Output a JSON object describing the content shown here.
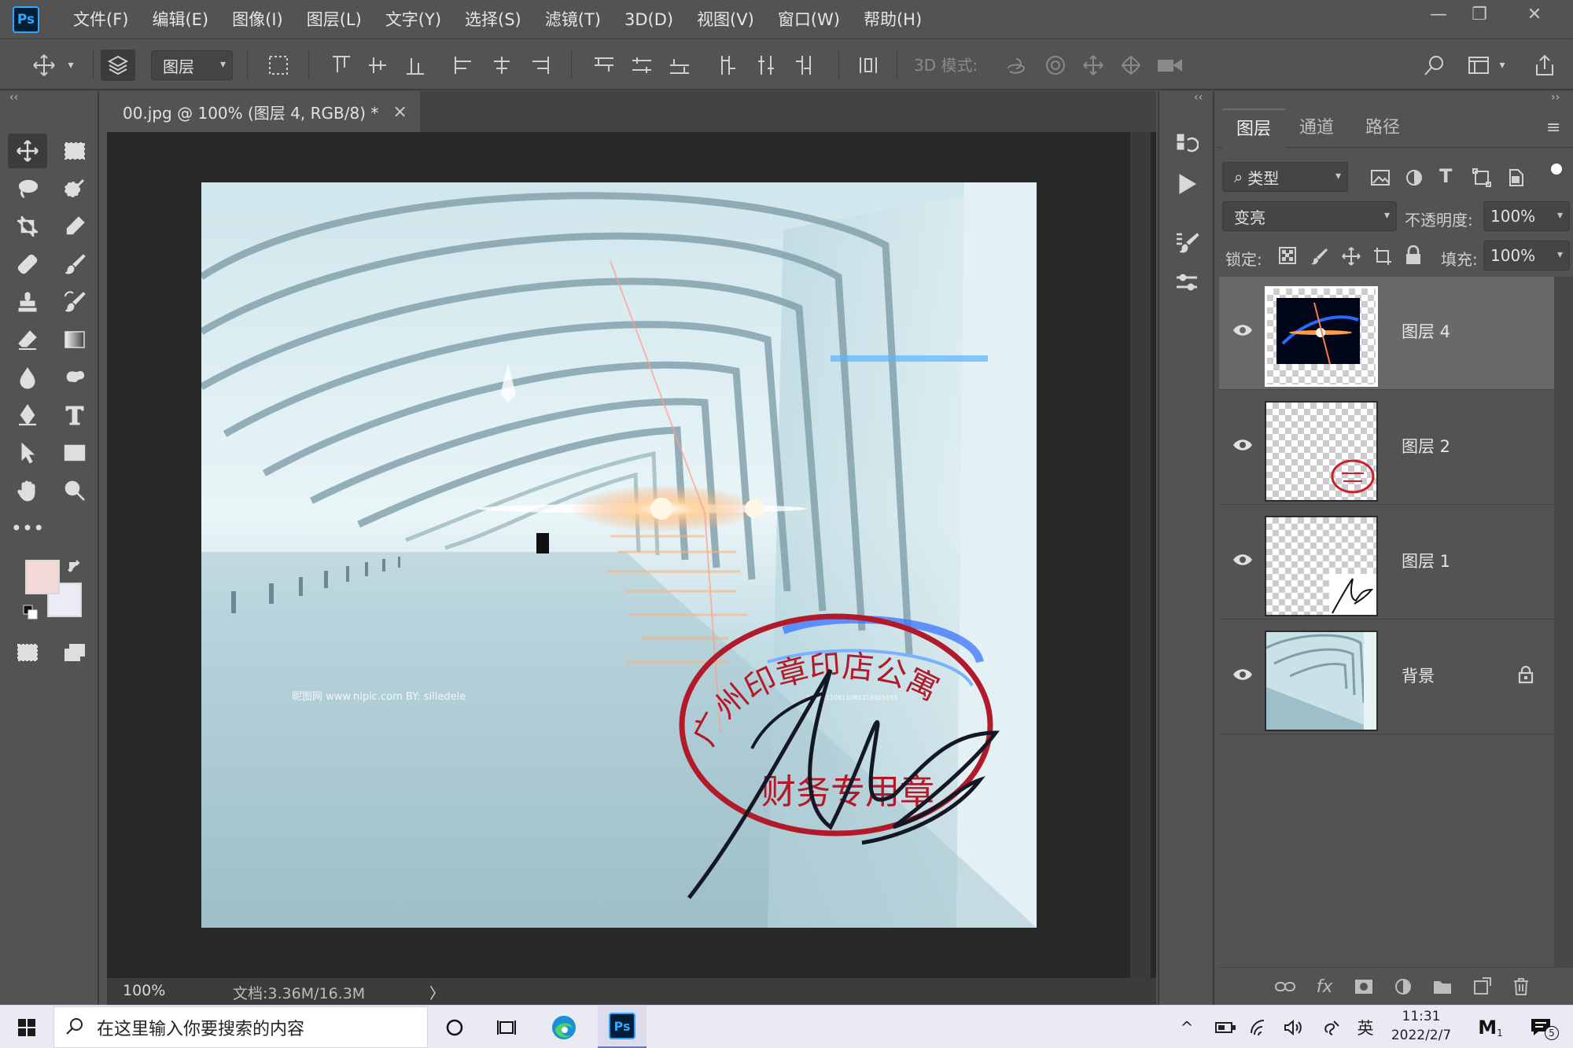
{
  "app": {
    "logo_text": "Ps",
    "accent": "#31a8ff"
  },
  "menu": [
    "文件(F)",
    "编辑(E)",
    "图像(I)",
    "图层(L)",
    "文字(Y)",
    "选择(S)",
    "滤镜(T)",
    "3D(D)",
    "视图(V)",
    "窗口(W)",
    "帮助(H)"
  ],
  "window_controls": {
    "minimize": "—",
    "restore": "❐",
    "close": "✕"
  },
  "options_bar": {
    "layer_select": "图层",
    "mode_3d_label": "3D 模式:"
  },
  "document": {
    "tab_title": "00.jpg @ 100% (图层 4, RGB/8) *",
    "tab_close": "×",
    "zoom": "100%",
    "doc_info": "文档:3.36M/16.3M",
    "status_arrow": "〉",
    "watermark": "昵图网 www.nipic.com   BY: silledele",
    "image_no": "No:20110811085316665165",
    "stamp_outer": "广州印章印店公寓",
    "stamp_inner": "财务专用章"
  },
  "colors": {
    "foreground": "#f2d9d6",
    "background": "#edeaf7"
  },
  "panel": {
    "tabs": [
      "图层",
      "通道",
      "路径"
    ],
    "active_tab": 0,
    "filter_label": "类型",
    "blend_mode": "变亮",
    "opacity_label": "不透明度:",
    "opacity_value": "100%",
    "lock_label": "锁定:",
    "fill_label": "填充:",
    "fill_value": "100%",
    "layers": [
      {
        "name": "图层 4",
        "selected": true,
        "locked": false,
        "visible": true
      },
      {
        "name": "图层 2",
        "selected": false,
        "locked": false,
        "visible": true
      },
      {
        "name": "图层 1",
        "selected": false,
        "locked": false,
        "visible": true
      },
      {
        "name": "背景",
        "selected": false,
        "locked": true,
        "visible": true
      }
    ]
  },
  "taskbar": {
    "search_placeholder": "在这里输入你要搜索的内容",
    "time": "11:31",
    "date": "2022/2/7",
    "ime": "英",
    "notif_count": "5",
    "im_badge": "1"
  }
}
